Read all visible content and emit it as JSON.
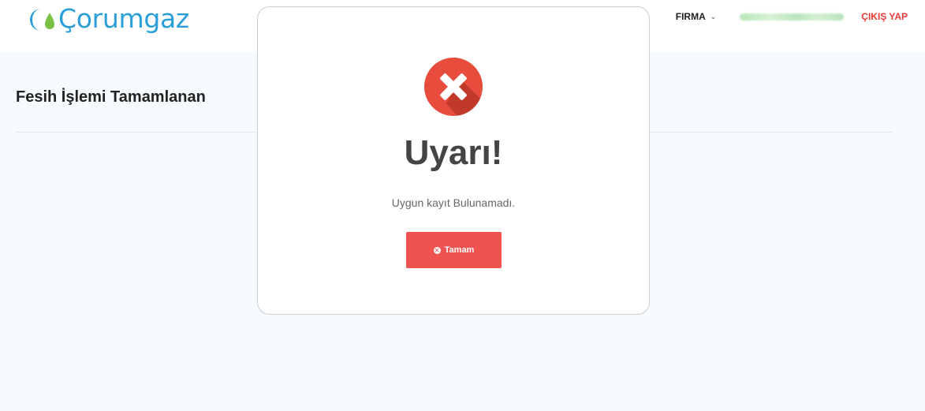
{
  "header": {
    "brand": "Çorumgaz",
    "nav": {
      "firma_label": "FIRMA",
      "user_name": "",
      "logout_label": "ÇIKIŞ YAP"
    }
  },
  "main": {
    "page_title": "Fesih İşlemi Tamamlanan"
  },
  "modal": {
    "title": "Uyarı!",
    "message": "Uygun kayıt Bulunamadı.",
    "button_label": "Tamam"
  },
  "colors": {
    "brand_blue": "#2a9fd8",
    "logout_red": "#e53935",
    "button_red": "#ef5350",
    "icon_red": "#e74c3c",
    "main_bg": "#f6fbfe"
  },
  "icons": {
    "logo": "corumgaz-logo-icon",
    "firma_chevron": "chevron-down-icon",
    "modal": "error-x-icon",
    "button": "close-circle-icon"
  }
}
